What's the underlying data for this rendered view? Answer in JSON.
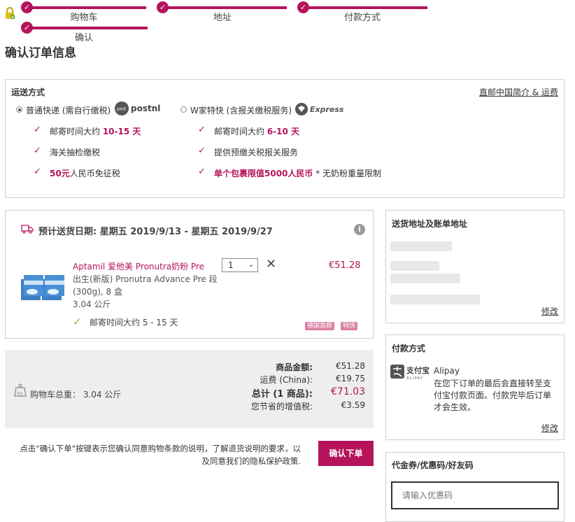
{
  "steps": [
    {
      "label": "购物车"
    },
    {
      "label": "地址"
    },
    {
      "label": "付款方式"
    },
    {
      "label": "确认"
    }
  ],
  "page_title": "确认订单信息",
  "shipping": {
    "title": "运送方式",
    "link": "直邮中国简介 & 运费",
    "option1": {
      "label": "普通快递 (需自行缴税)",
      "brand": "postnl",
      "brand_small": "post",
      "selected": true,
      "features": [
        {
          "pre": "邮寄时间大约 ",
          "hl": "10-15 天",
          "post": ""
        },
        {
          "pre": "海关抽检缴税",
          "hl": "",
          "post": ""
        },
        {
          "pre": "",
          "hl": "50元",
          "post": "人民币免征税"
        }
      ]
    },
    "option2": {
      "label": "W家特快 (含报关缴税服务)",
      "brand": "Express",
      "selected": false,
      "features": [
        {
          "pre": "邮寄时间大约 ",
          "hl": "6-10 天",
          "post": ""
        },
        {
          "pre": "提供预缴关税报关服务",
          "hl": "",
          "post": ""
        },
        {
          "pre": "",
          "hl": "单个包裹限值5000人民币",
          "post": " * 无奶粉重量限制"
        }
      ]
    }
  },
  "delivery": {
    "date_text": "预计送货日期: 星期五 2019/9/13 - 星期五 2019/9/27",
    "info_icon": "info-icon"
  },
  "product": {
    "name_line1": "Aptamil 爱他美 Pronutra奶粉 Pre",
    "desc_line1": "出生(新版) Pronutra Advance Pre 段",
    "desc_line2": "(300g), 8 盒",
    "weight": "3.04 公斤",
    "quantity": "1",
    "price": "€51.28",
    "ship_time": "邮寄时间大约 5 - 15 天",
    "tags": [
      "德国直邮",
      "特快"
    ]
  },
  "summary": {
    "cart_weight": "购物车总重： 3.04 公斤",
    "rows": [
      {
        "label": "商品金额:",
        "value": "€51.28"
      },
      {
        "label": "运费 (China):",
        "value": "€19.75"
      },
      {
        "label": "总计 (1 商品):",
        "value": "€71.03"
      },
      {
        "label": "您节省的增值税:",
        "value": "€3.59"
      }
    ]
  },
  "confirm": {
    "note_line1": "点击\"确认下单\"按键表示您确认同意购物条款的说明，了解退货说明的要求，以",
    "note_line2": "及同意我们的隐私保护政策.",
    "button": "确认下单"
  },
  "address": {
    "title": "送货地址及账单地址",
    "edit": "修改"
  },
  "payment": {
    "title": "付款方式",
    "logo_cn": "支付宝",
    "logo_en": "ALIPAY",
    "name": "Alipay",
    "desc_lines": [
      "在您下订单的最后会直接转至支",
      "付宝付款页面。付款完毕后订单",
      "才会生效。"
    ],
    "edit": "修改"
  },
  "coupon": {
    "title": "代金券/优惠码/好友码",
    "placeholder": "请输入优惠码"
  },
  "colors": {
    "accent": "#b5135c",
    "panel_bg": "#eeeeee"
  }
}
